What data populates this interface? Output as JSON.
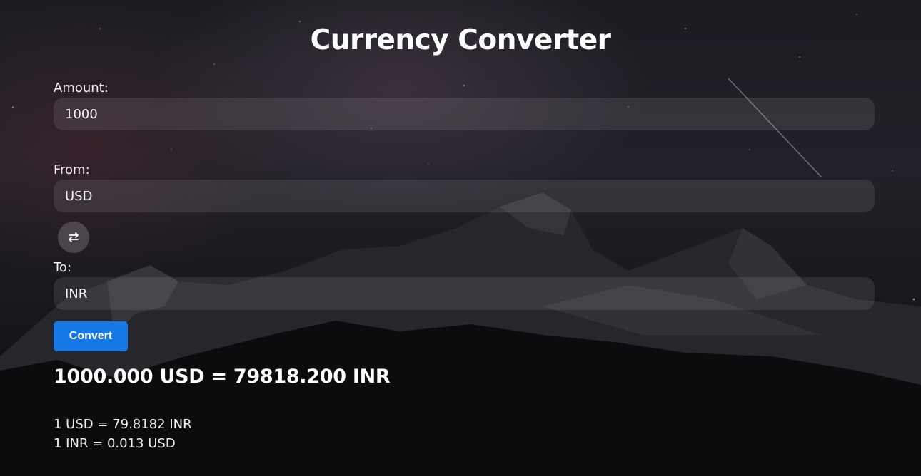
{
  "app": {
    "title": "Currency Converter"
  },
  "form": {
    "amount_label": "Amount:",
    "amount_value": "1000",
    "from_label": "From:",
    "from_value": "USD",
    "to_label": "To:",
    "to_value": "INR",
    "swap_icon": "swap-arrows-icon",
    "convert_label": "Convert"
  },
  "result": {
    "main": "1000.000 USD = 79818.200 INR",
    "rate_forward": "1 USD = 79.8182 INR",
    "rate_reverse": "1 INR = 0.013 USD"
  },
  "colors": {
    "accent": "#1677e6",
    "text": "#ffffff"
  }
}
